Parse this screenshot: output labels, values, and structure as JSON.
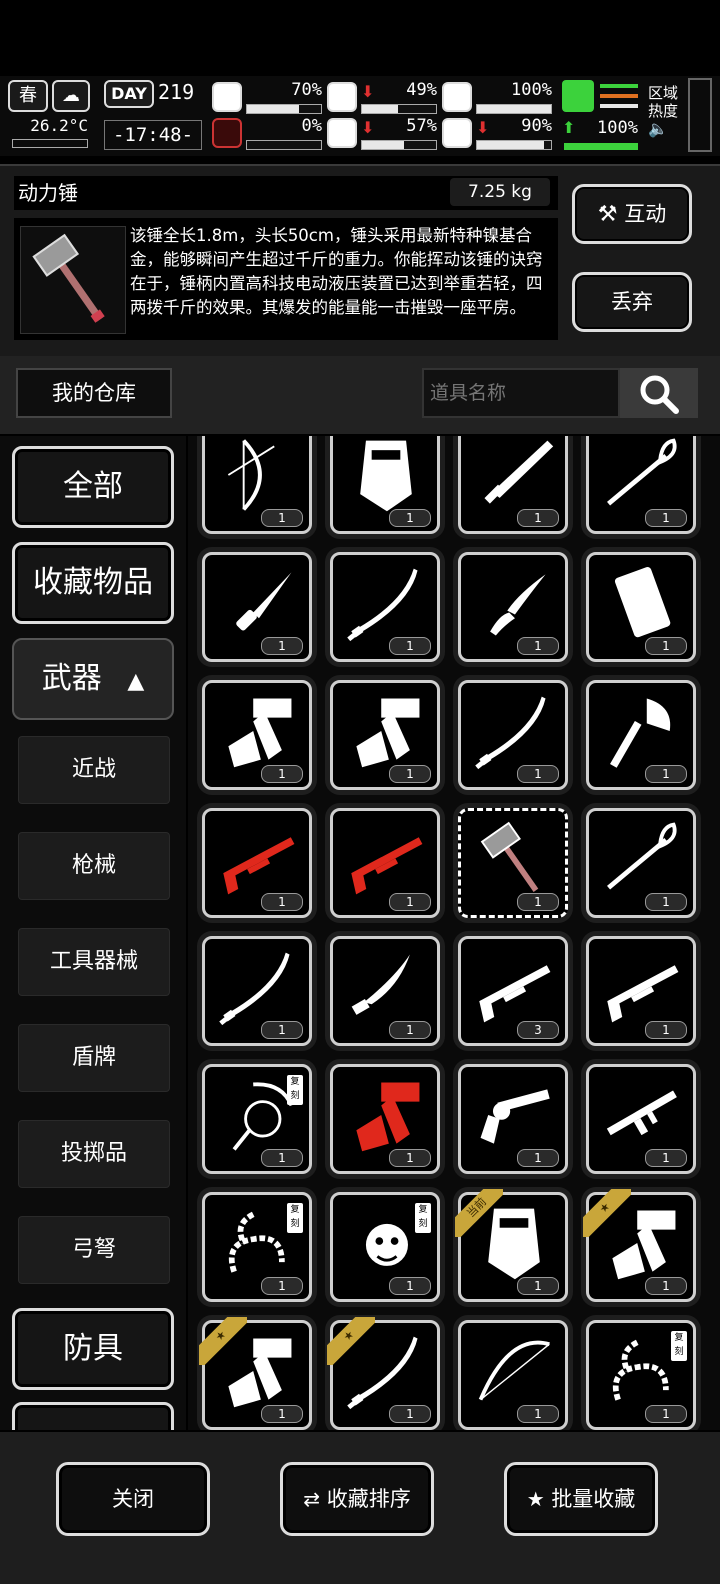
{
  "status": {
    "season": "春",
    "temperature": "26.2°C",
    "day_label": "DAY",
    "day": "219",
    "time": "-17:48-",
    "zone_label_1": "区域",
    "zone_label_2": "热度",
    "stats": [
      {
        "name": "health",
        "value": "70%",
        "fill": 0.7,
        "arrow": ""
      },
      {
        "name": "hunger",
        "value": "49%",
        "fill": 0.49,
        "arrow": "⬇"
      },
      {
        "name": "armor",
        "value": "100%",
        "fill": 1.0,
        "arrow": ""
      },
      {
        "name": "infection",
        "value": "0%",
        "fill": 0.0,
        "arrow": ""
      },
      {
        "name": "thirst",
        "value": "57%",
        "fill": 0.57,
        "arrow": "⬇"
      },
      {
        "name": "mood",
        "value": "90%",
        "fill": 0.9,
        "arrow": "⬇"
      }
    ],
    "stamina": {
      "value": "100%",
      "arrow": "⬆",
      "fill": 1.0
    }
  },
  "item": {
    "name": "动力锤",
    "weight": "7.25 kg",
    "description": "该锤全长1.8m，头长50cm，锤头采用最新特种镍基合金，能够瞬间产生超过千斤的重力。你能挥动该锤的诀窍在于，锤柄内置高科技电动液压装置已达到举重若轻，四两拨千斤的效果。其爆发的能量能一击摧毁一座平房。",
    "interact_label": "互动",
    "discard_label": "丢弃"
  },
  "warehouse": {
    "title": "我的仓库",
    "search_placeholder": "道具名称"
  },
  "categories": {
    "all": "全部",
    "favorites": "收藏物品",
    "weapons": "武器",
    "sub": [
      "近战",
      "枪械",
      "工具器械",
      "盾牌",
      "投掷品",
      "弓弩"
    ],
    "armor": "防具"
  },
  "grid_items": [
    {
      "icon": "compound-bow-icon",
      "count": "1"
    },
    {
      "icon": "riot-shield-icon",
      "count": "1"
    },
    {
      "icon": "broadsword-icon",
      "count": "1"
    },
    {
      "icon": "rapier-icon",
      "count": "1"
    },
    {
      "icon": "combat-knife-icon",
      "count": "1"
    },
    {
      "icon": "katana-icon",
      "count": "1"
    },
    {
      "icon": "folding-knife-icon",
      "count": "1"
    },
    {
      "icon": "ammo-box-icon",
      "count": "1"
    },
    {
      "icon": "tomahawk-icon",
      "count": "1"
    },
    {
      "icon": "tomahawk-icon",
      "count": "1"
    },
    {
      "icon": "katana-icon",
      "count": "1"
    },
    {
      "icon": "axe-icon",
      "count": "1"
    },
    {
      "icon": "shotgun-icon",
      "count": "1",
      "red": true
    },
    {
      "icon": "shotgun-icon",
      "count": "1",
      "red": true
    },
    {
      "icon": "power-hammer-icon",
      "count": "1",
      "current": true
    },
    {
      "icon": "rapier-icon",
      "count": "1"
    },
    {
      "icon": "katana-icon",
      "count": "1"
    },
    {
      "icon": "kukri-icon",
      "count": "1"
    },
    {
      "icon": "shotgun-icon",
      "count": "3"
    },
    {
      "icon": "shotgun-icon",
      "count": "1"
    },
    {
      "icon": "whip-icon",
      "count": "1",
      "tag": "复刻"
    },
    {
      "icon": "tomahawk-icon",
      "count": "1",
      "red": true
    },
    {
      "icon": "revolver-icon",
      "count": "1"
    },
    {
      "icon": "assault-rifle-icon",
      "count": "1"
    },
    {
      "icon": "bone-whip-icon",
      "count": "1",
      "tag": "复刻"
    },
    {
      "icon": "medusa-head-icon",
      "count": "1",
      "tag": "复刻"
    },
    {
      "icon": "riot-shield-icon",
      "count": "1",
      "ribbon": "当前"
    },
    {
      "icon": "tomahawk-icon",
      "count": "1",
      "ribbon": "★"
    },
    {
      "icon": "tomahawk-icon",
      "count": "1",
      "ribbon": "★"
    },
    {
      "icon": "katana-icon",
      "count": "1",
      "ribbon": "★"
    },
    {
      "icon": "recurve-bow-icon",
      "count": "1"
    },
    {
      "icon": "bone-whip-icon",
      "count": "1",
      "tag": "复刻"
    }
  ],
  "bottom": {
    "close_label": "关闭",
    "sort_label": "收藏排序",
    "batch_label": "批量收藏"
  },
  "colors": {
    "red_item": "#e0281c",
    "ribbon": "#c9a63a",
    "accent_green": "#3cd23c"
  }
}
